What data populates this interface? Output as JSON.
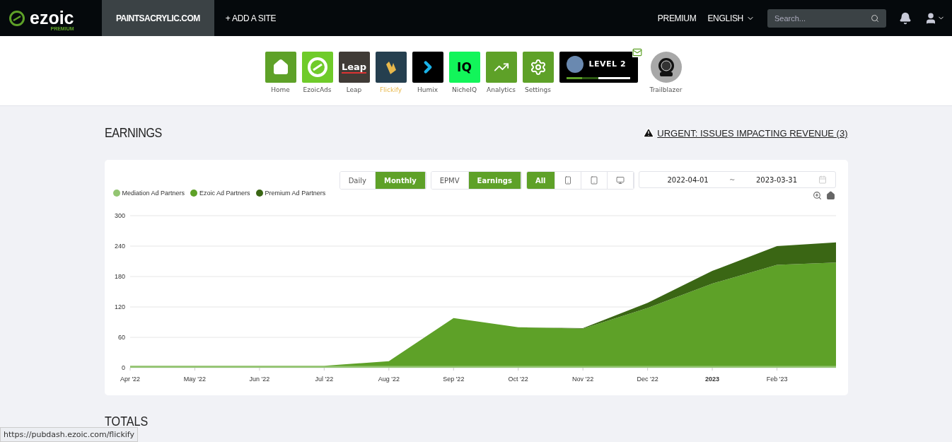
{
  "topbar": {
    "logo": "ezoic",
    "logo_badge": "PREMIUM",
    "site": "PAINTSACRYLIC.COM",
    "add_site": "+ ADD A SITE",
    "premium": "PREMIUM",
    "language": "ENGLISH",
    "search": {
      "placeholder": "Search..."
    }
  },
  "apps": [
    {
      "kind": "home",
      "label": "Home",
      "hovered": false
    },
    {
      "kind": "ezoicads",
      "label": "EzoicAds",
      "hovered": false
    },
    {
      "kind": "leap",
      "label": "Leap",
      "logo": "Leap",
      "hovered": false
    },
    {
      "kind": "flickify",
      "label": "Flickify",
      "hovered": true
    },
    {
      "kind": "humix",
      "label": "Humix",
      "hovered": false
    },
    {
      "kind": "nicheiq",
      "label": "NicheIQ",
      "logo": "IQ",
      "hovered": false
    },
    {
      "kind": "analytics",
      "label": "Analytics",
      "hovered": false
    },
    {
      "kind": "settings",
      "label": "Settings",
      "hovered": false
    }
  ],
  "level_badge": {
    "label": "LEVEL 2",
    "level": 0.5,
    "unread_mail": true
  },
  "trailblazer": {
    "label": "Trailblazer"
  },
  "earnings": {
    "title": "EARNINGS",
    "alert": "URGENT: ISSUES IMPACTING REVENUE (3)",
    "period": [
      {
        "label": "Daily",
        "selected": false
      },
      {
        "label": "Monthly",
        "selected": true
      }
    ],
    "metric": [
      {
        "label": "EPMV",
        "selected": false
      },
      {
        "label": "Earnings",
        "selected": true
      }
    ],
    "device": [
      {
        "kind": "text",
        "label": "All",
        "selected": true
      },
      {
        "kind": "phone",
        "selected": false
      },
      {
        "kind": "tablet",
        "selected": false
      },
      {
        "kind": "desktop",
        "selected": false
      }
    ],
    "date_from": "2022-04-01",
    "date_sep": "~",
    "date_to": "2023-03-31",
    "chart_data": {
      "type": "area",
      "stacked": true,
      "grid": true,
      "ylim": [
        0,
        300
      ],
      "yticks": [
        0,
        60,
        120,
        180,
        240,
        300
      ],
      "categories": [
        "Apr '22",
        "May '22",
        "Jun '22",
        "Jul '22",
        "Aug '22",
        "Sep '22",
        "Oct '22",
        "Nov '22",
        "Dec '22",
        "**2023**",
        "Feb '23",
        null
      ],
      "series": [
        {
          "name": "Mediation Ad Partners",
          "color": "#93c572",
          "values": [
            3,
            3,
            3,
            3,
            3,
            3,
            3,
            3,
            3,
            3,
            3,
            3
          ]
        },
        {
          "name": "Ezoic Ad Partners",
          "color": "#5ea128",
          "values": [
            1,
            1,
            1,
            1,
            10,
            95,
            77,
            74,
            115,
            163,
            200,
            205
          ]
        },
        {
          "name": "Premium Ad Partners",
          "color": "#3a6614",
          "values": [
            0,
            0,
            0,
            0,
            0,
            0,
            0,
            1,
            10,
            25,
            37,
            40
          ]
        }
      ]
    }
  },
  "totals": {
    "title": "TOTALS"
  },
  "status_url": "https://pubdash.ezoic.com/flickify"
}
